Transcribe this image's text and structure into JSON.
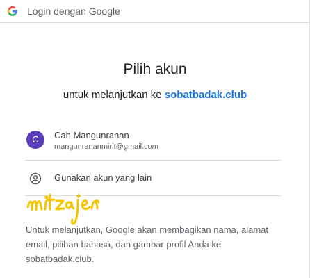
{
  "header": {
    "title": "Login dengan Google",
    "logo_icon": "google-g-icon"
  },
  "main": {
    "title": "Pilih akun",
    "subtitle_prefix": "untuk melanjutkan ke ",
    "subtitle_domain": "sobatbadak.club"
  },
  "account": {
    "avatar_initial": "C",
    "name": "Cah Mangunranan",
    "email": "mangunrananmirit@gmail.com"
  },
  "other_account": {
    "label": "Gunakan akun yang lain",
    "icon": "person-circle-icon"
  },
  "info_text": "Untuk melanjutkan, Google akan membagikan nama, alamat email, pilihan bahasa, dan gambar profil Anda ke sobatbadak.club.",
  "watermark": "mitzajen",
  "colors": {
    "link": "#1a73e8",
    "avatar": "#5a3db8",
    "watermark": "#f5c400",
    "divider": "#dadce0"
  }
}
